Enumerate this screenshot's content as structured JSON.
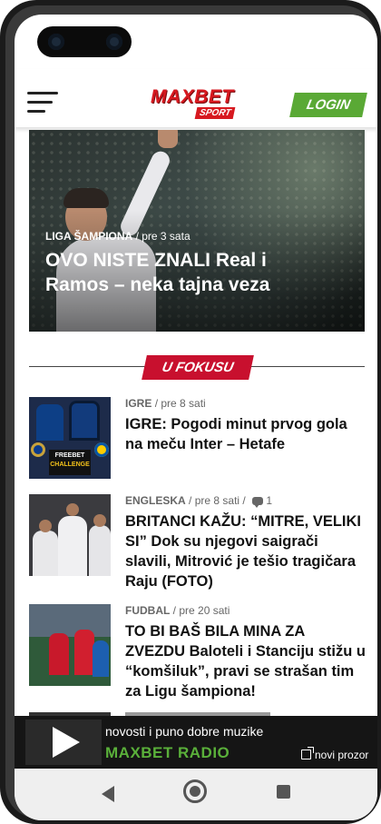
{
  "header": {
    "logo_main": "MAXBET",
    "logo_sub": "SPORT",
    "login_label": "LOGIN"
  },
  "hero": {
    "category": "LIGA ŠAMPIONA",
    "time": "pre 3 sata",
    "title": "OVO NISTE ZNALI Real i Ramos – neka tajna veza"
  },
  "focus": {
    "label": "U FOKUSU"
  },
  "articles": [
    {
      "category": "IGRE",
      "time": "pre 8 sati",
      "title": "IGRE: Pogodi minut prvog gola na meču Inter – Hetafe",
      "thumb_caption_top": "FREEBET",
      "thumb_caption_bottom": "CHALLENGE"
    },
    {
      "category": "ENGLESKA",
      "time": "pre 8 sati",
      "comments": "1",
      "title": "BRITANCI KAŽU: “MITRE, VELIKI SI” Dok su njegovi saigrači slavili, Mitrović je tešio tragičara Raju (FOTO)"
    },
    {
      "category": "FUDBAL",
      "time": "pre 20 sati",
      "title": "TO BI BAŠ BILA MINA ZA ZVEZDU Baloteli i Stanciju stižu u “komšiluk”, pravi se strašan tim za Ligu šampiona!"
    }
  ],
  "radio": {
    "text": "novosti i puno dobre muzike",
    "name": "MAXBET RADIO",
    "new_window": "novi prozor"
  },
  "colors": {
    "brand_red": "#d71920",
    "login_green": "#5aa935",
    "radio_green": "#5ab03a"
  }
}
